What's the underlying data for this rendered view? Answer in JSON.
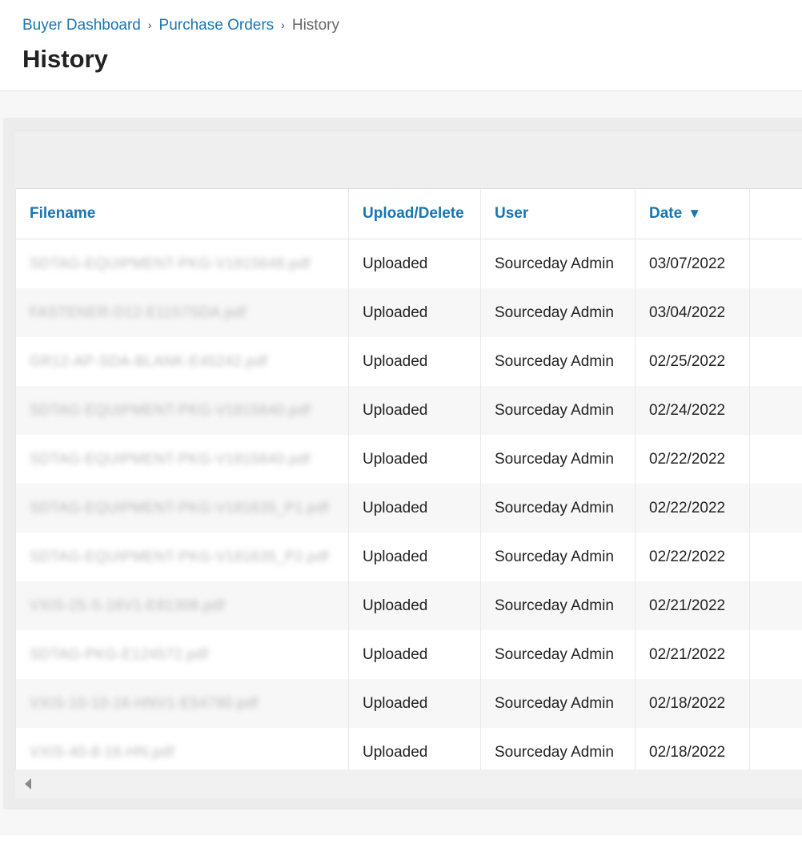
{
  "breadcrumb": {
    "items": [
      "Buyer Dashboard",
      "Purchase Orders"
    ],
    "separator": "›",
    "current": "History"
  },
  "page": {
    "title": "History"
  },
  "table": {
    "columns": [
      "Filename",
      "Upload/Delete",
      "User",
      "Date"
    ],
    "sort_indicator": "▼",
    "rows": [
      {
        "filename": "SDTAG-EQUIPMENT-PKG-V1815648.pdf",
        "action": "Uploaded",
        "user": "Sourceday Admin",
        "date": "03/07/2022"
      },
      {
        "filename": "FASTENER-D12-E1157SDA.pdf",
        "action": "Uploaded",
        "user": "Sourceday Admin",
        "date": "03/04/2022"
      },
      {
        "filename": "GR12-AP-SDA-BLANK-E45242.pdf",
        "action": "Uploaded",
        "user": "Sourceday Admin",
        "date": "02/25/2022"
      },
      {
        "filename": "SDTAG-EQUIPMENT-PKG-V1815640.pdf",
        "action": "Uploaded",
        "user": "Sourceday Admin",
        "date": "02/24/2022"
      },
      {
        "filename": "SDTAG-EQUIPMENT-PKG-V1815640.pdf",
        "action": "Uploaded",
        "user": "Sourceday Admin",
        "date": "02/22/2022"
      },
      {
        "filename": "SDTAG-EQUIPMENT-PKG-V181635_P1.pdf",
        "action": "Uploaded",
        "user": "Sourceday Admin",
        "date": "02/22/2022"
      },
      {
        "filename": "SDTAG-EQUIPMENT-PKG-V181635_P2.pdf",
        "action": "Uploaded",
        "user": "Sourceday Admin",
        "date": "02/22/2022"
      },
      {
        "filename": "VXIS-25-S-16V1-E81308.pdf",
        "action": "Uploaded",
        "user": "Sourceday Admin",
        "date": "02/21/2022"
      },
      {
        "filename": "SDTAG-PKG-E124572.pdf",
        "action": "Uploaded",
        "user": "Sourceday Admin",
        "date": "02/21/2022"
      },
      {
        "filename": "VXIS-10-10-16-HNV1-E54790.pdf",
        "action": "Uploaded",
        "user": "Sourceday Admin",
        "date": "02/18/2022"
      },
      {
        "filename": "VXIS-40-8-16-HN.pdf",
        "action": "Uploaded",
        "user": "Sourceday Admin",
        "date": "02/18/2022"
      }
    ]
  },
  "icons": {
    "sort": "sort-descending-icon",
    "scroll_left": "scroll-left-icon"
  },
  "colors": {
    "link": "#1a75b0",
    "row_alt": "#f7f7f7"
  }
}
